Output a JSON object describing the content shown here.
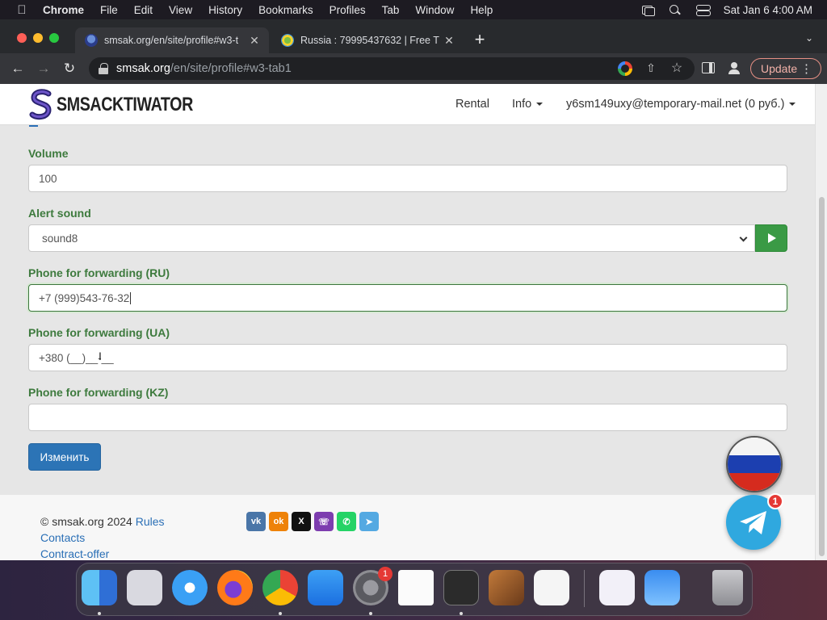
{
  "menubar": {
    "app_name": "Chrome",
    "menus": [
      "File",
      "Edit",
      "View",
      "History",
      "Bookmarks",
      "Profiles",
      "Tab",
      "Window",
      "Help"
    ],
    "clock": "Sat Jan 6  4:00 AM"
  },
  "browser": {
    "tabs": [
      {
        "title": "smsak.org/en/site/profile#w3-t",
        "active": true
      },
      {
        "title": "Russia : 79995437632 | Free T",
        "active": false
      }
    ],
    "url_host": "smsak.org",
    "url_path": "/en/site/profile#w3-tab1",
    "update_label": "Update"
  },
  "site": {
    "logo_text": "SMSACKTIWATOR",
    "nav": {
      "rental": "Rental",
      "info": "Info",
      "account": "y6sm149uxy@temporary-mail.net (0 руб.)"
    }
  },
  "form": {
    "volume": {
      "label": "Volume",
      "value": "100"
    },
    "alert_sound": {
      "label": "Alert sound",
      "value": "sound8"
    },
    "phone_ru": {
      "label": "Phone for forwarding (RU)",
      "value": "+7 (999)543-76-32"
    },
    "phone_ua": {
      "label": "Phone for forwarding (UA)",
      "value": "+380 (__)__-__"
    },
    "phone_kz": {
      "label": "Phone for forwarding (KZ)",
      "value": ""
    },
    "submit_label": "Изменить"
  },
  "footer": {
    "copyright": "© smsak.org 2024",
    "rules": "Rules",
    "contacts": "Contacts",
    "contract": "Contract-offer",
    "social": [
      "vk",
      "ok",
      "x",
      "viber",
      "whatsapp",
      "telegram"
    ]
  },
  "floating": {
    "telegram_badge": "1"
  },
  "dock": {
    "apps": [
      "finder",
      "launchpad",
      "safari",
      "firefox",
      "chrome",
      "app-store",
      "system-settings",
      "textedit",
      "terminal",
      "garageband",
      "vscode",
      "visual-studio",
      "weather",
      "trash"
    ],
    "settings_badge": "1"
  },
  "colors": {
    "label_green": "#3d7a3d",
    "button_blue": "#2c74b6",
    "play_green": "#3a9a45",
    "link_blue": "#2a6fb6"
  }
}
